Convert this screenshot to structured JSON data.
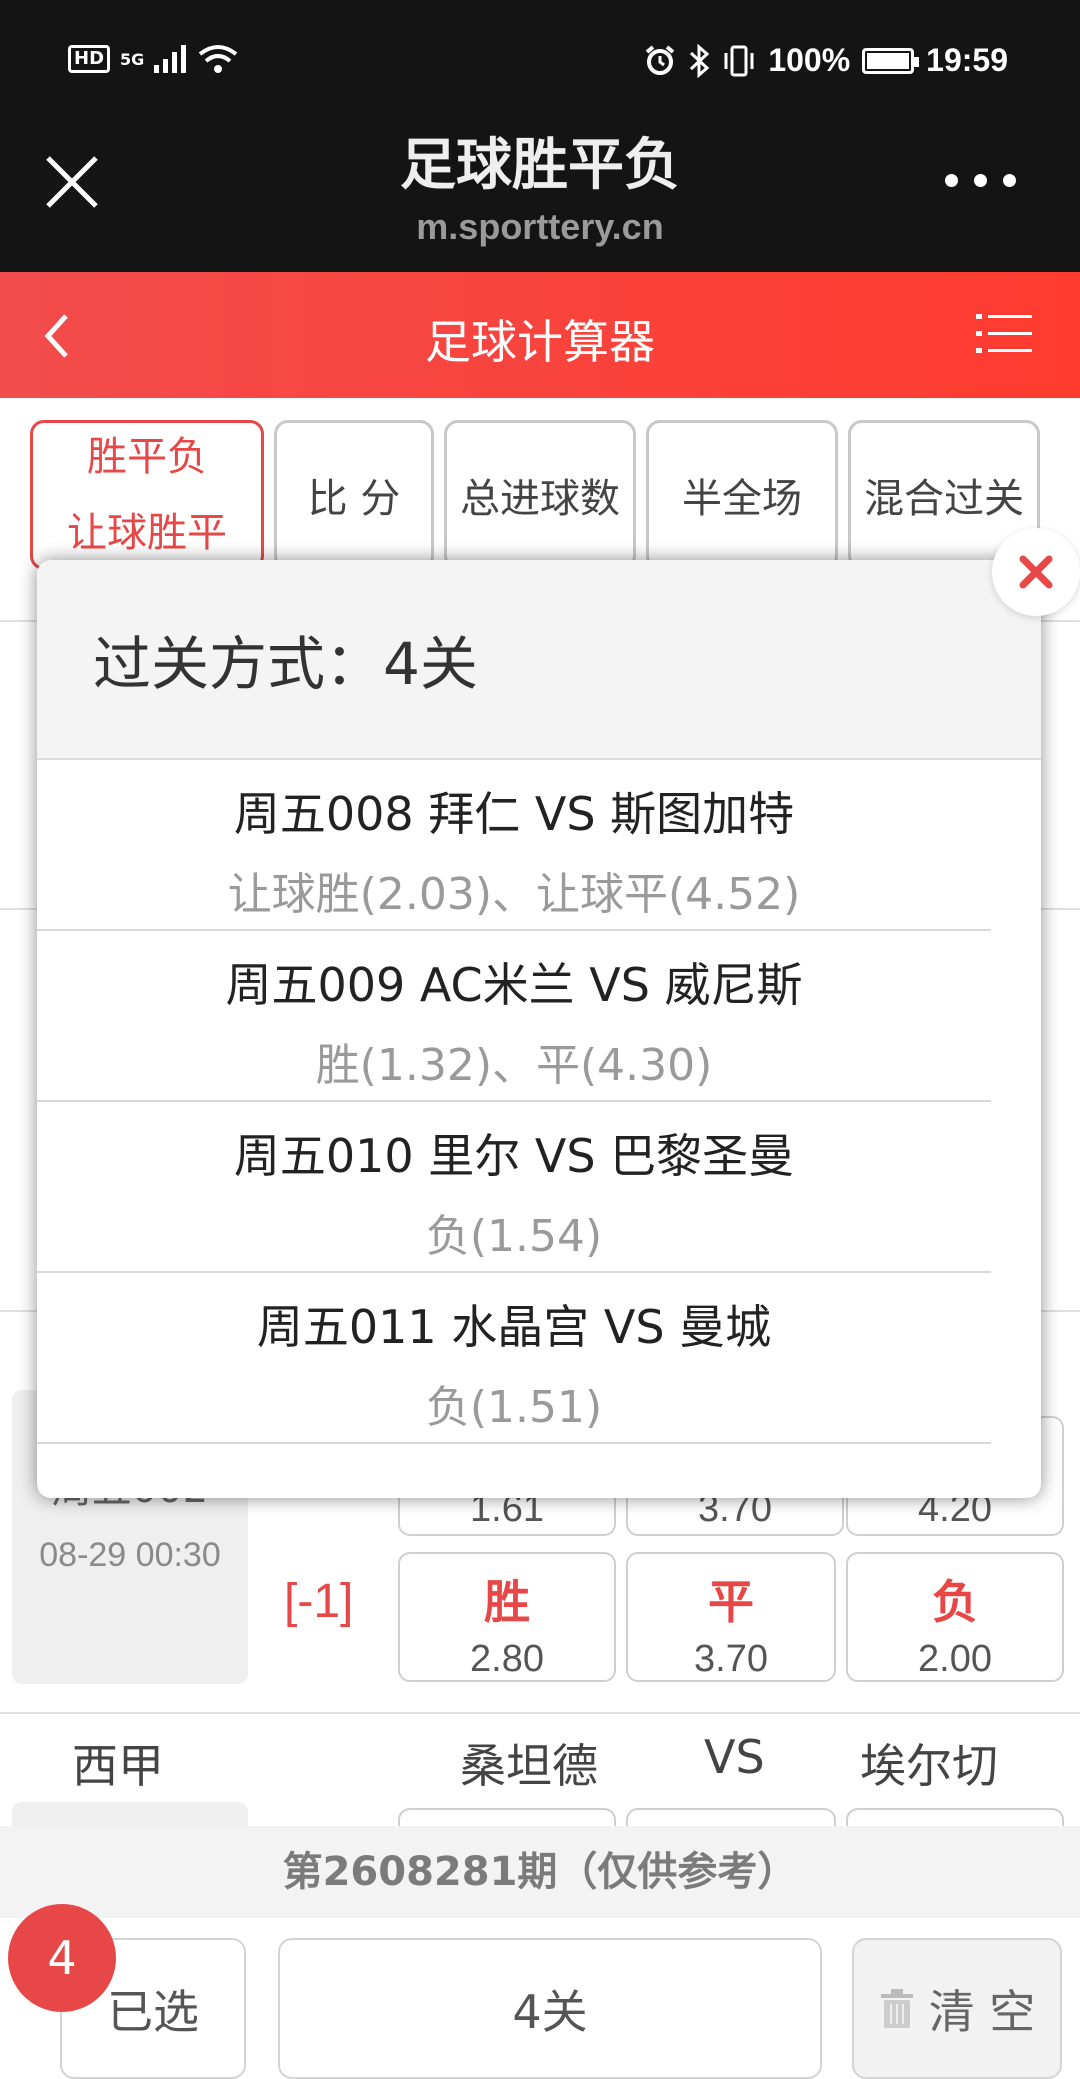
{
  "status_bar": {
    "network": "5G",
    "hd": "HD",
    "battery": "100%",
    "battery_level": 1.0,
    "time": "19:59"
  },
  "browser": {
    "title": "足球胜平负",
    "url": "m.sporttery.cn"
  },
  "app_header": {
    "title": "足球计算器"
  },
  "tabs": [
    {
      "line1": "胜平负",
      "line2": "让球胜平"
    },
    {
      "label": "比 分"
    },
    {
      "label": "总进球数"
    },
    {
      "label": "半全场"
    },
    {
      "label": "混合过关"
    }
  ],
  "background": {
    "match_id": "周五002",
    "match_time": "08-29 00:30",
    "prev_odds": [
      "1.61",
      "3.70",
      "4.20"
    ],
    "handicap": "[-1]",
    "odds": [
      {
        "label": "胜",
        "value": "2.80"
      },
      {
        "label": "平",
        "value": "3.70"
      },
      {
        "label": "负",
        "value": "2.00"
      }
    ],
    "next_row": {
      "league": "西甲",
      "home": "桑坦德",
      "vs": "VS",
      "away": "埃尔切"
    }
  },
  "modal": {
    "title": "过关方式：4关",
    "items": [
      {
        "match": "周五008 拜仁 VS 斯图加特",
        "picks": "让球胜(2.03)、让球平(4.52)"
      },
      {
        "match": "周五009 AC米兰 VS 威尼斯",
        "picks": "胜(1.32)、平(4.30)"
      },
      {
        "match": "周五010 里尔 VS 巴黎圣曼",
        "picks": "负(1.54)"
      },
      {
        "match": "周五011 水晶宫 VS 曼城",
        "picks": "负(1.51)"
      }
    ]
  },
  "footer": {
    "issue": "第2608281期（仅供参考）",
    "selected_count": "4",
    "selected_label": "已选",
    "pass_label": "4关",
    "clear_label": "清 空"
  },
  "colors": {
    "accent": "#e84747",
    "header_red": "#f24c4c",
    "dark_bar": "#141414"
  }
}
